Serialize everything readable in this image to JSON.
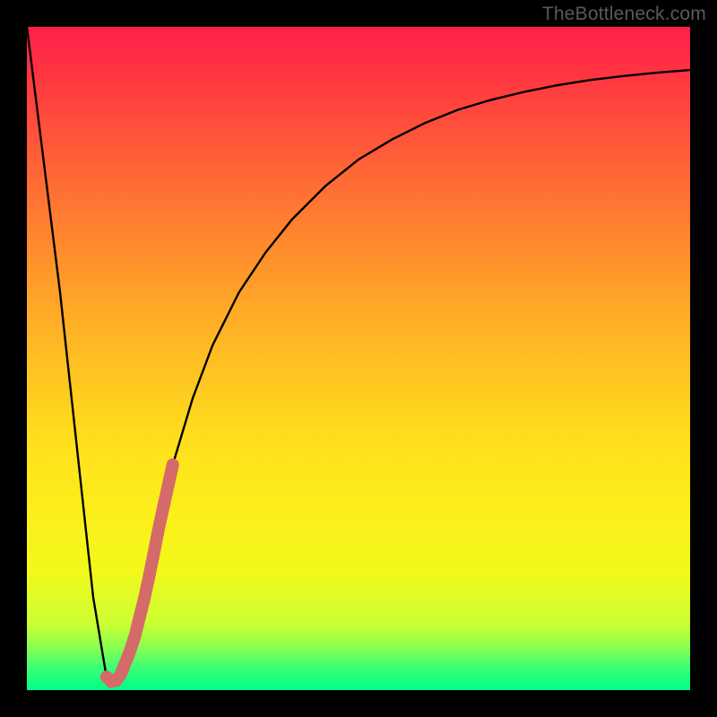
{
  "attribution": "TheBottleneck.com",
  "colors": {
    "frame": "#000000",
    "curve": "#000000",
    "highlight": "#d46a6a",
    "gradient_top": "#ff1f4a",
    "gradient_bottom": "#00ff88"
  },
  "chart_data": {
    "type": "line",
    "title": "",
    "xlabel": "",
    "ylabel": "",
    "xlim": [
      0,
      100
    ],
    "ylim": [
      0,
      100
    ],
    "series": [
      {
        "name": "bottleneck-curve",
        "x": [
          0,
          5,
          10,
          12,
          13,
          14,
          16,
          18,
          20,
          22,
          25,
          28,
          32,
          36,
          40,
          45,
          50,
          55,
          60,
          65,
          70,
          75,
          80,
          85,
          90,
          95,
          100
        ],
        "values": [
          100,
          60,
          14,
          2,
          1,
          2,
          7,
          15,
          25,
          34,
          44,
          52,
          60,
          66,
          71,
          76,
          80,
          83,
          85.5,
          87.5,
          89,
          90.2,
          91.2,
          92,
          92.6,
          93.1,
          93.5
        ]
      }
    ],
    "highlight_segment": {
      "series": "bottleneck-curve",
      "x_start": 12,
      "x_end": 22,
      "approx_values_start": 2,
      "approx_values_end": 34
    },
    "grid": false,
    "legend": false
  }
}
